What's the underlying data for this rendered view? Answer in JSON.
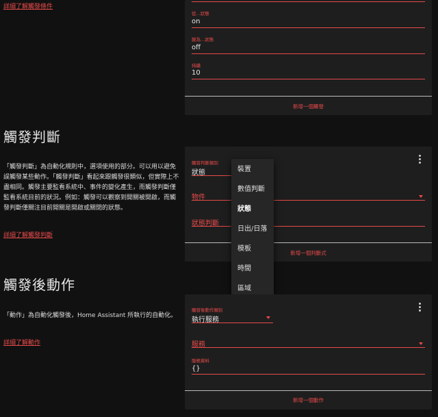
{
  "triggers_section": {
    "learn_more": "詳細了解觸發條件",
    "card": {
      "fields": [
        {
          "label": "從...狀態",
          "value": "on"
        },
        {
          "label": "變為...狀態",
          "value": "off"
        },
        {
          "label": "持續",
          "value": "10"
        }
      ],
      "add_button": "新增一個觸發"
    }
  },
  "conditions_section": {
    "title": "觸發判斷",
    "description": "「觸發判斷」為自動化規則中，選項使用的部分。可以用以避免誤觸發某些動作。「觸發判斷」看起來跟觸發很類似，但實際上不盡相同。觸發主要監看系統中、事件的變化產生，而觸發判斷僅監看系統目前的狀況。例如：觸發可以觀察到開關被開啟，而觸發判斷僅關注目前開關是開啟或關閉的狀態。",
    "learn_more": "詳細了解觸發判斷",
    "card": {
      "type_label": "觸發判斷類別",
      "type_value": "狀態",
      "entity_label": "物件",
      "state_label": "狀態判斷",
      "add_button": "新增一個判斷式",
      "menu_icon": "more-vert-icon"
    },
    "dropdown": {
      "options": [
        "裝置",
        "數值判斷",
        "狀態",
        "日出/日落",
        "模板",
        "時間",
        "區域"
      ],
      "selected": "狀態"
    }
  },
  "actions_section": {
    "title": "觸發後動作",
    "description": "「動作」為自動化觸發後，Home Assistant 所執行的自動化。",
    "learn_more": "詳細了解動作",
    "card": {
      "type_label": "觸發後動作類別",
      "type_value": "執行服務",
      "service_label": "服務",
      "data_label": "服務資料",
      "data_value": "{}",
      "add_button": "新增一個動作",
      "menu_icon": "more-vert-icon"
    }
  },
  "colors": {
    "accent": "#e84a4a",
    "card": "#1e1e1e",
    "background": "#111111"
  }
}
